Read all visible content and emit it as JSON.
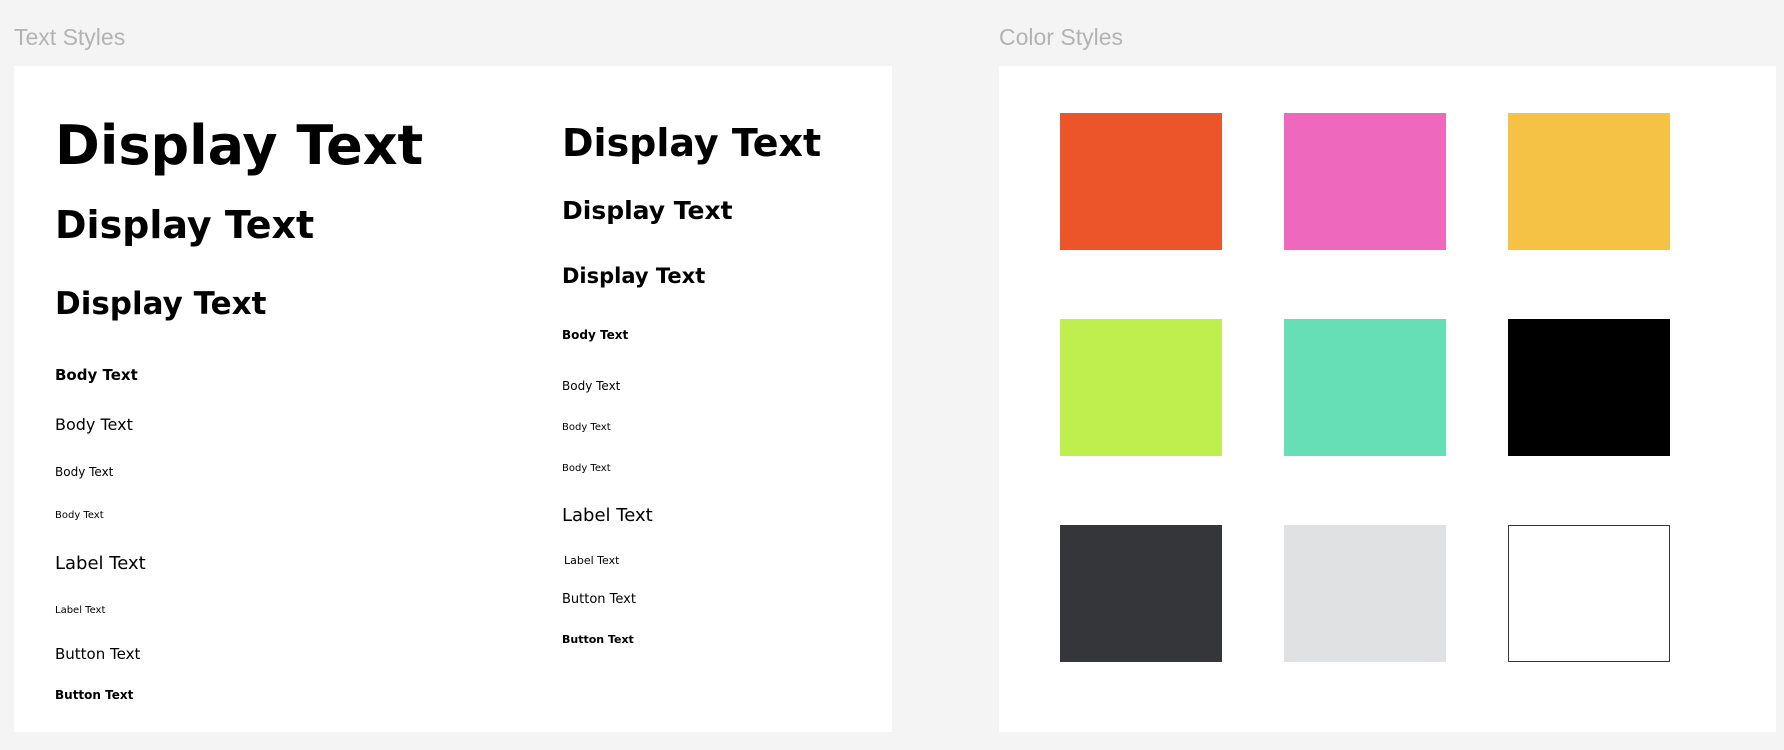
{
  "sections": {
    "text_styles": "Text Styles",
    "color_styles": "Color Styles"
  },
  "text_styles": {
    "left": {
      "display_1": "Display Text",
      "display_2": "Display Text",
      "display_3": "Display Text",
      "body_1": "Body Text",
      "body_2": "Body Text",
      "body_3": "Body Text",
      "body_4": "Body Text",
      "label_1": "Label Text",
      "label_2": "Label Text",
      "button_1": "Button Text",
      "button_2": "Button Text"
    },
    "right": {
      "display_1": "Display Text",
      "display_2": "Display Text",
      "display_3": "Display Text",
      "body_1": "Body Text",
      "body_2": "Body Text",
      "body_3": "Body Text",
      "body_4": "Body Text",
      "label_1": "Label Text",
      "label_2": "Label Text",
      "button_1": "Button Text",
      "button_2": "Button Text"
    }
  },
  "color_styles": [
    {
      "name": "orange",
      "hex": "#ec542a"
    },
    {
      "name": "pink",
      "hex": "#ee69be"
    },
    {
      "name": "yellow",
      "hex": "#f5c245"
    },
    {
      "name": "lime",
      "hex": "#bfee4f"
    },
    {
      "name": "mint",
      "hex": "#66dfb7"
    },
    {
      "name": "black",
      "hex": "#000000"
    },
    {
      "name": "charcoal",
      "hex": "#35363a"
    },
    {
      "name": "light-gray",
      "hex": "#e0e1e2"
    },
    {
      "name": "white",
      "hex": "#ffffff"
    }
  ]
}
